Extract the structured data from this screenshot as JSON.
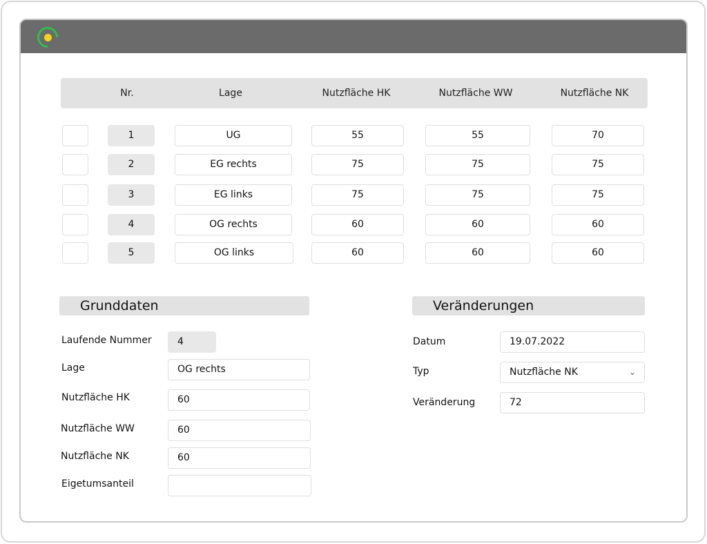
{
  "table": {
    "columns": [
      "",
      "Nr.",
      "Lage",
      "Nutzfläche HK",
      "Nutzfläche WW",
      "Nutzfläche NK"
    ],
    "rows": [
      {
        "nr": "1",
        "lage": "UG",
        "hk": "55",
        "ww": "55",
        "nk": "70"
      },
      {
        "nr": "2",
        "lage": "EG rechts",
        "hk": "75",
        "ww": "75",
        "nk": "75"
      },
      {
        "nr": "3",
        "lage": "EG links",
        "hk": "75",
        "ww": "75",
        "nk": "75"
      },
      {
        "nr": "4",
        "lage": "OG rechts",
        "hk": "60",
        "ww": "60",
        "nk": "60"
      },
      {
        "nr": "5",
        "lage": "OG links",
        "hk": "60",
        "ww": "60",
        "nk": "60"
      }
    ]
  },
  "grunddaten": {
    "title": "Grunddaten",
    "fields": [
      {
        "label": "Laufende Nummer",
        "value": "4"
      },
      {
        "label": "Lage",
        "value": "OG rechts"
      },
      {
        "label": "Nutzfläche HK",
        "value": "60"
      },
      {
        "label": "Nutzfläche WW",
        "value": "60"
      },
      {
        "label": "Nutzfläche NK",
        "value": "60"
      },
      {
        "label": "Eigetumsanteil",
        "value": ""
      }
    ]
  },
  "veraenderungen": {
    "title": "Veränderungen",
    "fields": [
      {
        "label": "Datum",
        "value": "19.07.2022"
      },
      {
        "label": "Typ",
        "value": "Nutzfläche NK"
      },
      {
        "label": "Veränderung",
        "value": "72"
      }
    ],
    "typ_icon": "chevron-down-icon"
  },
  "colors": {
    "titlebar": "#6b6b6b",
    "logo_ring": "#2fbf4a",
    "logo_dot": "#f4d21c",
    "header_bg": "#e2e2e2"
  }
}
